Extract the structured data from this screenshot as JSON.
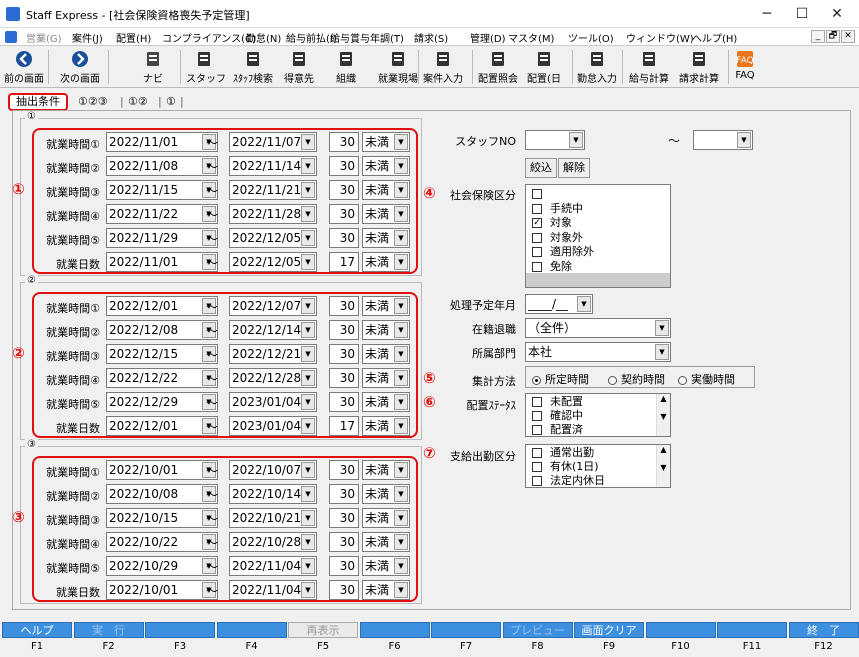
{
  "window": {
    "title": "Staff Express - [社会保険資格喪失予定管理]",
    "minimize": "─",
    "maximize": "☐",
    "close": "✕"
  },
  "menu": [
    "営業(G)",
    "案件(J)",
    "配置(H)",
    "コンプライアンス(C)",
    "勤怠(N)",
    "給与前払(I)",
    "給与賞与年調(T)",
    "請求(S)",
    "管理(D)",
    "マスタ(M)",
    "ツール(O)",
    "ウィンドウ(W)",
    "ヘルプ(H)"
  ],
  "mdi": [
    "_",
    "🗗",
    "✕"
  ],
  "toolbar": [
    "前の画面",
    "次の画面",
    "ナビ",
    "スタッフ",
    "ｽﾀｯﾌ検索",
    "得意先",
    "組織",
    "就業現場",
    "案件入力",
    "配置照会",
    "配置(日",
    "勤怠入力",
    "給与計算",
    "請求計算",
    "FAQ"
  ],
  "tabs": [
    "抽出条件",
    "①②③",
    "①②",
    "①"
  ],
  "groups": [
    {
      "label": "①",
      "marker": "①",
      "rows": [
        {
          "label": "就業時間①",
          "from": "2022/11/01",
          "to": "2022/11/07",
          "num": "30",
          "cond": "未満"
        },
        {
          "label": "就業時間②",
          "from": "2022/11/08",
          "to": "2022/11/14",
          "num": "30",
          "cond": "未満"
        },
        {
          "label": "就業時間③",
          "from": "2022/11/15",
          "to": "2022/11/21",
          "num": "30",
          "cond": "未満"
        },
        {
          "label": "就業時間④",
          "from": "2022/11/22",
          "to": "2022/11/28",
          "num": "30",
          "cond": "未満"
        },
        {
          "label": "就業時間⑤",
          "from": "2022/11/29",
          "to": "2022/12/05",
          "num": "30",
          "cond": "未満"
        },
        {
          "label": "就業日数",
          "from": "2022/11/01",
          "to": "2022/12/05",
          "num": "17",
          "cond": "未満"
        }
      ]
    },
    {
      "label": "②",
      "marker": "②",
      "rows": [
        {
          "label": "就業時間①",
          "from": "2022/12/01",
          "to": "2022/12/07",
          "num": "30",
          "cond": "未満"
        },
        {
          "label": "就業時間②",
          "from": "2022/12/08",
          "to": "2022/12/14",
          "num": "30",
          "cond": "未満"
        },
        {
          "label": "就業時間③",
          "from": "2022/12/15",
          "to": "2022/12/21",
          "num": "30",
          "cond": "未満"
        },
        {
          "label": "就業時間④",
          "from": "2022/12/22",
          "to": "2022/12/28",
          "num": "30",
          "cond": "未満"
        },
        {
          "label": "就業時間⑤",
          "from": "2022/12/29",
          "to": "2023/01/04",
          "num": "30",
          "cond": "未満"
        },
        {
          "label": "就業日数",
          "from": "2022/12/01",
          "to": "2023/01/04",
          "num": "17",
          "cond": "未満"
        }
      ]
    },
    {
      "label": "③",
      "marker": "③",
      "rows": [
        {
          "label": "就業時間①",
          "from": "2022/10/01",
          "to": "2022/10/07",
          "num": "30",
          "cond": "未満"
        },
        {
          "label": "就業時間②",
          "from": "2022/10/08",
          "to": "2022/10/14",
          "num": "30",
          "cond": "未満"
        },
        {
          "label": "就業時間③",
          "from": "2022/10/15",
          "to": "2022/10/21",
          "num": "30",
          "cond": "未満"
        },
        {
          "label": "就業時間④",
          "from": "2022/10/22",
          "to": "2022/10/28",
          "num": "30",
          "cond": "未満"
        },
        {
          "label": "就業時間⑤",
          "from": "2022/10/29",
          "to": "2022/11/04",
          "num": "30",
          "cond": "未満"
        },
        {
          "label": "就業日数",
          "from": "2022/10/01",
          "to": "2022/11/04",
          "num": "30",
          "cond": "未満"
        }
      ]
    }
  ],
  "tilde": "～",
  "right": {
    "staff_no_label": "スタッフNO",
    "staff_from": "",
    "staff_to": "",
    "narrow_btn": "絞込",
    "clear_btn": "解除",
    "shaho_marker": "④",
    "shaho_label": "社会保険区分",
    "shaho_items": [
      {
        "label": "",
        "checked": false
      },
      {
        "label": "手続中",
        "checked": false
      },
      {
        "label": "対象",
        "checked": true
      },
      {
        "label": "対象外",
        "checked": false
      },
      {
        "label": "適用除外",
        "checked": false
      },
      {
        "label": "免除",
        "checked": false
      }
    ],
    "plan_label": "処理予定年月",
    "plan_value": "____/__",
    "zaiseki_label": "在籍退職",
    "zaiseki_value": "（全件）",
    "dept_label": "所属部門",
    "dept_value": "本社",
    "calc_marker": "⑤",
    "calc_label": "集計方法",
    "calc_options": [
      "所定時間",
      "契約時間",
      "実働時間"
    ],
    "haichi_marker": "⑥",
    "haichi_label": "配置ｽﾃｰﾀｽ",
    "haichi_items": [
      "未配置",
      "確認中",
      "配置済"
    ],
    "shikyu_marker": "⑦",
    "shikyu_label": "支給出勤区分",
    "shikyu_items": [
      "通常出勤",
      "有休(1日)",
      "法定内休日"
    ]
  },
  "fkeys": [
    {
      "label": "ヘルプ",
      "key": "F1"
    },
    {
      "label": "実　行",
      "key": "F2"
    },
    {
      "label": "",
      "key": "F3"
    },
    {
      "label": "",
      "key": "F4"
    },
    {
      "label": "再表示",
      "key": "F5"
    },
    {
      "label": "",
      "key": "F6"
    },
    {
      "label": "",
      "key": "F7"
    },
    {
      "label": "プレビュー",
      "key": "F8"
    },
    {
      "label": "画面クリア",
      "key": "F9"
    },
    {
      "label": "",
      "key": "F10"
    },
    {
      "label": "",
      "key": "F11"
    },
    {
      "label": "終　了",
      "key": "F12"
    }
  ]
}
